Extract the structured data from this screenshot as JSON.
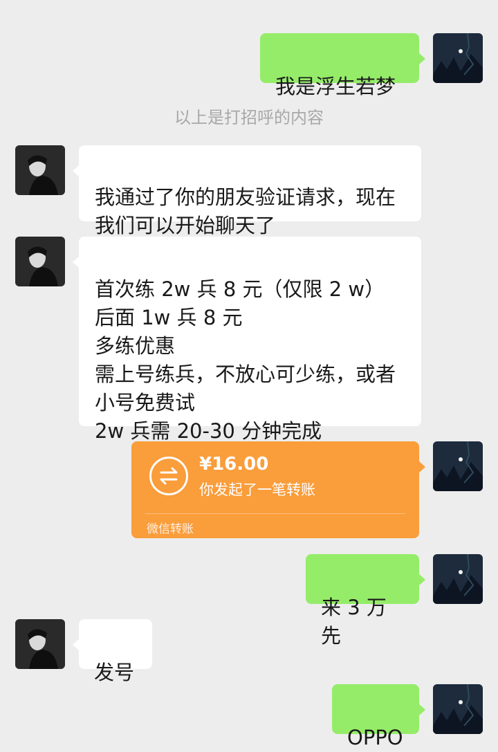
{
  "system_notice": "以上是打招呼的内容",
  "messages": [
    {
      "side": "right",
      "text": "我是浮生若梦"
    },
    {
      "side": "left",
      "text": "我通过了你的朋友验证请求，现在\n我们可以开始聊天了"
    },
    {
      "side": "left",
      "text": "首次练 2w 兵 8 元（仅限 2 w）\n后面 1w 兵 8 元\n多练优惠\n需上号练兵，不放心可少练，或者\n小号免费试\n2w 兵需 20-30 分钟完成"
    },
    {
      "side": "right",
      "type": "transfer",
      "amount": "¥16.00",
      "desc": "你发起了一笔转账",
      "brand": "微信转账"
    },
    {
      "side": "right",
      "text": "来 3 万先"
    },
    {
      "side": "left",
      "text": "发号"
    },
    {
      "side": "right",
      "text": "OPPO"
    }
  ],
  "colors": {
    "background": "#ededed",
    "bubble_self": "#95ec69",
    "bubble_other": "#ffffff",
    "transfer": "#fa9d3b",
    "notice": "#a8a8a8"
  },
  "icons": {
    "self_avatar": "night-sky-moon-avatar",
    "other_avatar": "portrait-bw-avatar",
    "transfer": "transfer-arrows-icon"
  }
}
